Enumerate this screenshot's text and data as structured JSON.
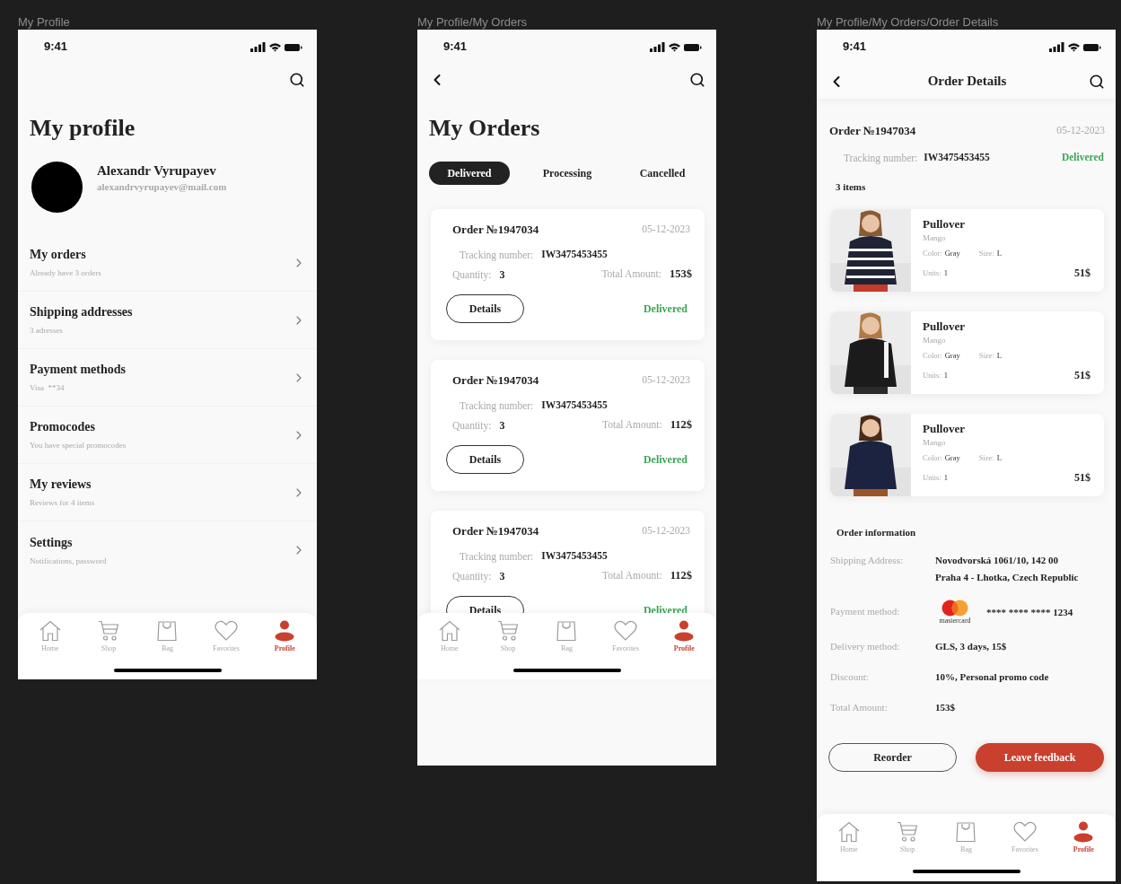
{
  "frames": [
    {
      "kind": "profile",
      "label": "My Profile",
      "time": "9:41",
      "title": "My profile",
      "user": {
        "name": "Alexandr Vyrupayev",
        "email": "alexandrvyrupayev@mail.com"
      },
      "menu": [
        {
          "title": "My orders",
          "subtitle": "Already have 3 orders"
        },
        {
          "title": "Shipping addresses",
          "subtitle": "3 adresses"
        },
        {
          "title": "Payment methods",
          "subtitle": "Visa  **34"
        },
        {
          "title": "Promocodes",
          "subtitle": "You have special promocodes"
        },
        {
          "title": "My reviews",
          "subtitle": "Reviews for 4 items"
        },
        {
          "title": "Settings",
          "subtitle": "Notifications, password"
        }
      ],
      "tab_bar": [
        {
          "label": "Home",
          "selected": false
        },
        {
          "label": "Shop",
          "selected": false
        },
        {
          "label": "Bag",
          "selected": false
        },
        {
          "label": "Favorites",
          "selected": false
        },
        {
          "label": "Profile",
          "selected": true
        }
      ]
    },
    {
      "kind": "orders",
      "label": "My Profile/My Orders",
      "time": "9:41",
      "title": "My Orders",
      "filters": [
        {
          "label": "Delivered",
          "selected": true
        },
        {
          "label": "Processing",
          "selected": false
        },
        {
          "label": "Cancelled",
          "selected": false
        }
      ],
      "orders": [
        {
          "number": "Order №1947034",
          "date": "05-12-2023",
          "tracking_label": "Tracking number:",
          "tracking": "IW3475453455",
          "quantity_label": "Quantity:",
          "quantity": "3",
          "total_label": "Total Amount:",
          "total": "153$",
          "button": "Details",
          "status": "Delivered"
        },
        {
          "number": "Order №1947034",
          "date": "05-12-2023",
          "tracking_label": "Tracking number:",
          "tracking": "IW3475453455",
          "quantity_label": "Quantity:",
          "quantity": "3",
          "total_label": "Total Amount:",
          "total": "112$",
          "button": "Details",
          "status": "Delivered"
        },
        {
          "number": "Order №1947034",
          "date": "05-12-2023",
          "tracking_label": "Tracking number:",
          "tracking": "IW3475453455",
          "quantity_label": "Quantity:",
          "quantity": "3",
          "total_label": "Total Amount:",
          "total": "112$",
          "button": "Details",
          "status": "Delivered"
        }
      ],
      "tab_bar": [
        {
          "label": "Home",
          "selected": false
        },
        {
          "label": "Shop",
          "selected": false
        },
        {
          "label": "Bag",
          "selected": false
        },
        {
          "label": "Favorites",
          "selected": false
        },
        {
          "label": "Profile",
          "selected": true
        }
      ]
    },
    {
      "kind": "order_details",
      "label": "My Profile/My Orders/Order Details",
      "time": "9:41",
      "title": "Order Details",
      "order": {
        "number": "Order №1947034",
        "date": "05-12-2023",
        "tracking_label": "Tracking number:",
        "tracking": "IW3475453455",
        "status": "Delivered",
        "count": "3 items"
      },
      "items": [
        {
          "name": "Pullover",
          "brand": "Mango",
          "color_label": "Color:",
          "color_name": "Gray",
          "size_label": "Size:",
          "size": "L",
          "units_label": "Units:",
          "units": "1",
          "price": "51$"
        },
        {
          "name": "Pullover",
          "brand": "Mango",
          "color_label": "Color:",
          "color_name": "Gray",
          "size_label": "Size:",
          "size": "L",
          "units_label": "Units:",
          "units": "1",
          "price": "51$"
        },
        {
          "name": "Pullover",
          "brand": "Mango",
          "color_label": "Color:",
          "color_name": "Gray",
          "size_label": "Size:",
          "size": "L",
          "units_label": "Units:",
          "units": "1",
          "price": "51$"
        }
      ],
      "info_title": "Order information",
      "info": [
        {
          "kind": "text",
          "label": "Shipping Address:",
          "lines": [
            "Novodvorská 1061/10, 142 00",
            "Praha 4 - Lhotka, Czech Republic"
          ]
        },
        {
          "kind": "card",
          "label": "Payment method:",
          "card_brand": "mastercard",
          "lines": [
            "**** **** **** 1234"
          ]
        },
        {
          "kind": "text",
          "label": "Delivery method:",
          "lines": [
            "GLS, 3 days, 15$"
          ]
        },
        {
          "kind": "text",
          "label": "Discount:",
          "lines": [
            "10%, Personal promo code"
          ]
        },
        {
          "kind": "text",
          "label": "Total Amount:",
          "lines": [
            "153$"
          ]
        }
      ],
      "buttons": [
        {
          "kind": "outline",
          "label": "Reorder"
        },
        {
          "kind": "primary",
          "label": "Leave feedback"
        }
      ],
      "tab_bar": [
        {
          "label": "Home",
          "selected": false
        },
        {
          "label": "Shop",
          "selected": false
        },
        {
          "label": "Bag",
          "selected": false
        },
        {
          "label": "Favorites",
          "selected": false
        },
        {
          "label": "Profile",
          "selected": true
        }
      ]
    }
  ]
}
